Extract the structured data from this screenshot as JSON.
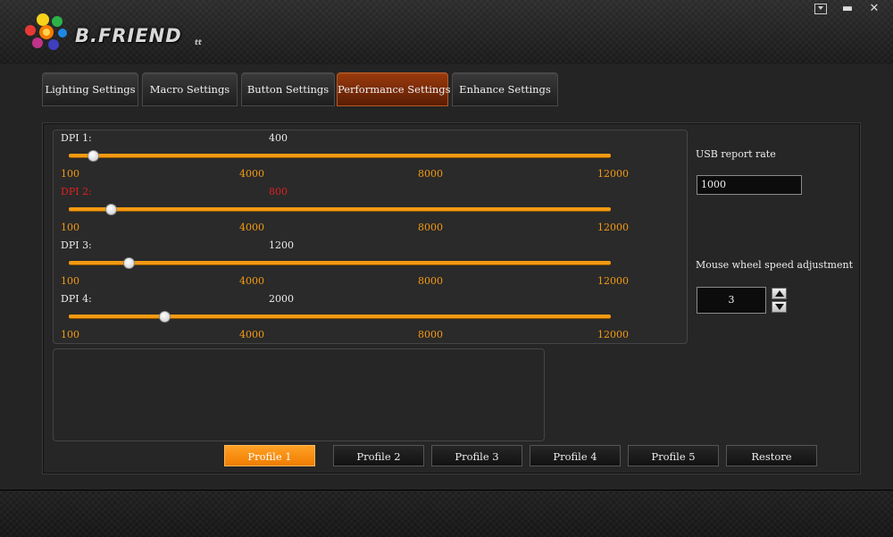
{
  "app": {
    "brand": "B.FRIEND",
    "brand_sub": "tt",
    "controls": {
      "menu_icon": "dropdown-menu-icon",
      "minimize": "▬",
      "close": "✕"
    }
  },
  "tabs": [
    {
      "label": "Lighting Settings",
      "active": false
    },
    {
      "label": "Macro Settings",
      "active": false
    },
    {
      "label": "Button Settings",
      "active": false
    },
    {
      "label": "Performance Settings",
      "active": true
    },
    {
      "label": "Enhance Settings",
      "active": false
    }
  ],
  "dpi": {
    "min": 100,
    "max": 12000,
    "ticks": [
      "100",
      "4000",
      "8000",
      "12000"
    ],
    "levels": [
      {
        "label": "DPI 1:",
        "value": 400,
        "display": "400",
        "selected": false
      },
      {
        "label": "DPI 2:",
        "value": 800,
        "display": "800",
        "selected": true
      },
      {
        "label": "DPI 3:",
        "value": 1200,
        "display": "1200",
        "selected": false
      },
      {
        "label": "DPI 4:",
        "value": 2000,
        "display": "2000",
        "selected": false
      }
    ]
  },
  "usb": {
    "label": "USB report rate",
    "value": "1000"
  },
  "wheel": {
    "label": "Mouse wheel speed adjustment",
    "value": "3"
  },
  "profiles": [
    {
      "label": "Profile 1",
      "active": true
    },
    {
      "label": "Profile 2",
      "active": false
    },
    {
      "label": "Profile 3",
      "active": false
    },
    {
      "label": "Profile 4",
      "active": false
    },
    {
      "label": "Profile 5",
      "active": false
    }
  ],
  "restore_label": "Restore",
  "colors": {
    "accent": "#f39a12",
    "selected_dpi": "#e02020",
    "active_tab": "#9a3a0c",
    "active_profile": "#ff8c0a"
  }
}
